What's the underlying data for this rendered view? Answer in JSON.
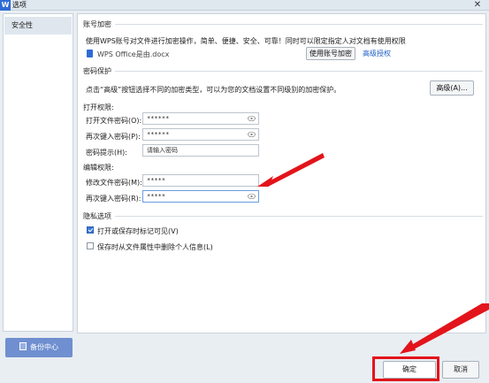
{
  "window": {
    "title": "选项",
    "app_icon": "W"
  },
  "sidebar": {
    "items": [
      {
        "label": "安全性"
      }
    ],
    "backup_label": "备份中心"
  },
  "account_encryption": {
    "title": "账号加密",
    "description": "使用WPS账号对文件进行加密操作，简单、便捷、安全、可靠！同时可以限定指定人对文档有使用权限",
    "file_name": "WPS Office是由.docx",
    "encrypt_button": "使用账号加密",
    "advanced_link": "高级授权"
  },
  "password_protection": {
    "title": "密码保护",
    "description": "点击“高级”按钮选择不同的加密类型，可以为您的文档设置不同级别的加密保护。",
    "advanced_button": "高级(A)...",
    "open_permissions": {
      "title": "打开权限:",
      "open_password_label": "打开文件密码(O):",
      "open_password_value": "******",
      "reenter_open_label": "再次键入密码(P):",
      "reenter_open_value": "******",
      "hint_label": "密码提示(H):",
      "hint_placeholder": "请输入密码"
    },
    "edit_permissions": {
      "title": "编辑权限:",
      "edit_password_label": "修改文件密码(M):",
      "edit_password_value": "*****",
      "reenter_edit_label": "再次键入密码(R):",
      "reenter_edit_value": "*****"
    }
  },
  "privacy": {
    "title": "隐私选项",
    "options": [
      {
        "label": "打开或保存时标记可见(V)",
        "checked": true
      },
      {
        "label": "保存时从文件属性中删除个人信息(L)",
        "checked": false
      }
    ]
  },
  "footer": {
    "ok_label": "确定",
    "cancel_label": "取消"
  },
  "colors": {
    "annotation_red": "#e3141b",
    "accent_blue": "#2f6bd6"
  }
}
